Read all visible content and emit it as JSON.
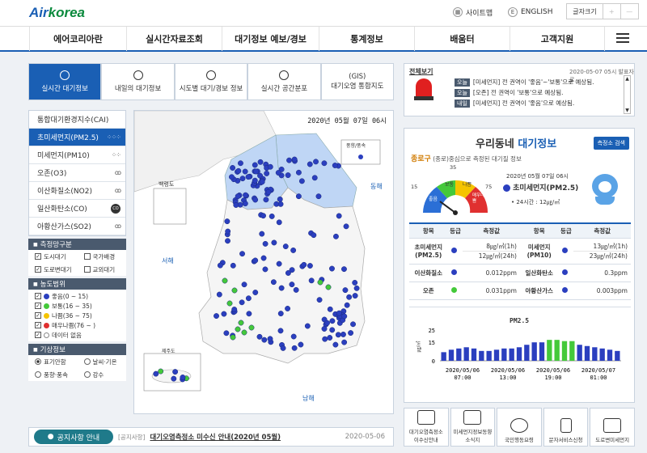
{
  "header": {
    "logo_air": "Air",
    "logo_korea": "korea",
    "sitemap": "사이트맵",
    "english": "ENGLISH",
    "font_size": "글자크기",
    "font_plus": "+",
    "font_minus": "—"
  },
  "gnb": [
    "에어코리아란",
    "실시간자료조회",
    "대기정보 예보/경보",
    "통계정보",
    "배움터",
    "고객지원"
  ],
  "tabs": [
    "실시간 대기정보",
    "내일의 대기정보",
    "시도별 대기/경보 정보",
    "실시간 공간분포",
    "(GIS)\n대기오염 통합지도"
  ],
  "left_nav": {
    "items": [
      "통합대기환경지수(CAI)",
      "초미세먼지(PM2.5)",
      "미세먼지(PM10)",
      "오존(O3)",
      "이산화질소(NO2)",
      "일산화탄소(CO)",
      "아황산가스(SO2)"
    ],
    "station_title": "측정망구분",
    "stations": [
      "도시대기",
      "국가배경",
      "도로변대기",
      "교외대기"
    ],
    "conc_title": "농도범위",
    "ranges": [
      "좋음(0 ~ 15)",
      "보통(16 ~ 35)",
      "나쁨(36 ~ 75)",
      "매우나쁨(76 ~ )",
      "데이터 없음"
    ],
    "weather_title": "기상정보",
    "weather": [
      "표기안함",
      "날씨·기온",
      "풍향·풍속",
      "강수"
    ]
  },
  "map": {
    "datetime": "2020년 05월 07일 06시",
    "legend": "풍향/풍속",
    "labels": [
      "백령도",
      "동해",
      "서해",
      "제주도",
      "남해"
    ]
  },
  "notice": {
    "button": "공지사항 안내",
    "tag": "[공지사항]",
    "title": "대기오염측정소 미수신 안내(2020년 05월)",
    "date": "2020-05-06"
  },
  "alert": {
    "title": "전체보기",
    "issued": "2020-05-07 05시 발표자료",
    "rows": [
      {
        "day": "오늘",
        "text": "[미세먼지] 전 권역이 '좋음'~'보통'으로 예상됨."
      },
      {
        "day": "오늘",
        "text": "[오존] 전 권역이 '보통'으로 예상됨."
      },
      {
        "day": "내일",
        "text": "[미세먼지] 전 권역이 '좋음'으로 예상됨."
      }
    ]
  },
  "neighborhood": {
    "title_prefix": "우리동네",
    "title_suffix": "대기정보",
    "search_btn": "측정소 검색",
    "gu": "종로구",
    "gu_desc": "(종로)중심으로 측정된 대기질 정보",
    "datetime": "2020년 05월 07일 06시",
    "pollutant": "초미세먼지(PM2.5)",
    "avg24": "• 24시간 : 12㎍/㎥",
    "gauge_nums": [
      "15",
      "35",
      "75"
    ],
    "gauge_labels": [
      "좋음",
      "보통",
      "나쁨",
      "매우나쁨"
    ],
    "table_headers": [
      "항목",
      "등급",
      "측정값",
      "항목",
      "등급",
      "측정값"
    ],
    "rows": [
      {
        "i1": "초미세먼지\n(PM2.5)",
        "v1a": "8㎍/㎥(1h)",
        "v1b": "12㎍/㎥(24h)",
        "i2": "미세먼지\n(PM10)",
        "v2a": "13㎍/㎥(1h)",
        "v2b": "23㎍/㎥(24h)"
      },
      {
        "i1": "이산화질소",
        "v1a": "0.012ppm",
        "v1b": "",
        "i2": "일산화탄소",
        "v2a": "0.3ppm",
        "v2b": ""
      },
      {
        "i1": "오존",
        "v1a": "0.031ppm",
        "v1b": "",
        "i2": "아황산가스",
        "v2a": "0.003ppm",
        "v2b": ""
      }
    ],
    "chart_title": "PM2.5",
    "y_label": "㎍/㎥",
    "x_ticks": [
      "2020/05/06\n07:00",
      "2020/05/06\n13:00",
      "2020/05/06\n19:00",
      "2020/05/07\n01:00"
    ]
  },
  "chart_data": {
    "type": "bar",
    "title": "PM2.5",
    "ylabel": "㎍/㎥",
    "ylim": [
      0,
      25
    ],
    "y_ticks": [
      "25",
      "15",
      "0"
    ],
    "values": [
      7,
      9,
      10,
      11,
      10,
      8,
      8,
      9,
      10,
      10,
      11,
      13,
      15,
      15,
      17,
      17,
      16,
      16,
      13,
      12,
      11,
      10,
      9,
      8
    ],
    "colors": [
      "#2b3fbf",
      "#2b3fbf",
      "#2b3fbf",
      "#2b3fbf",
      "#2b3fbf",
      "#2b3fbf",
      "#2b3fbf",
      "#2b3fbf",
      "#2b3fbf",
      "#2b3fbf",
      "#2b3fbf",
      "#2b3fbf",
      "#2b3fbf",
      "#2b3fbf",
      "#44c93a",
      "#44c93a",
      "#44c93a",
      "#44c93a",
      "#2b3fbf",
      "#2b3fbf",
      "#2b3fbf",
      "#2b3fbf",
      "#2b3fbf",
      "#2b3fbf"
    ]
  },
  "quick_links": [
    "대기오염측정소\n이수신안내",
    "미세먼지정보동향\n소식지",
    "국민행동요령",
    "문자서비스신청",
    "도로변미세먼지"
  ],
  "colors": {
    "good": "#2b3fbf",
    "normal": "#44c93a",
    "bad": "#f5c400",
    "very_bad": "#e03030",
    "accent": "#1a5fb4"
  }
}
